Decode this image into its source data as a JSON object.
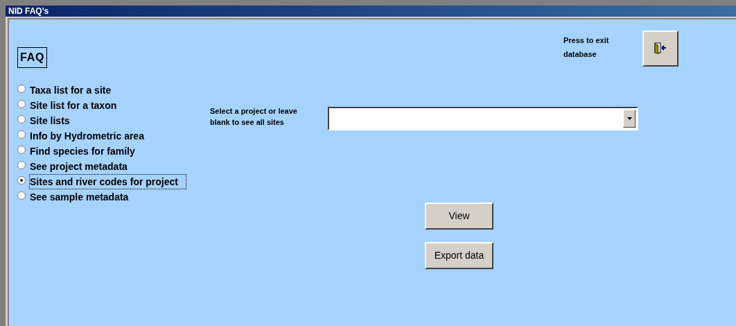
{
  "window": {
    "title": "NID FAQ's"
  },
  "heading": "FAQ",
  "options": [
    {
      "label": "Taxa list for a site",
      "selected": false
    },
    {
      "label": "Site list for a taxon",
      "selected": false
    },
    {
      "label": "Site lists",
      "selected": false
    },
    {
      "label": "Info by Hydrometric area",
      "selected": false
    },
    {
      "label": "Find species for family",
      "selected": false
    },
    {
      "label": "See project metadata",
      "selected": false
    },
    {
      "label": "Sites and river codes for project",
      "selected": true
    },
    {
      "label": "See sample metadata",
      "selected": false
    }
  ],
  "project_select": {
    "label": "Select a project or leave blank to see all sites"
  },
  "buttons": [
    "View",
    "Export data"
  ],
  "exit": {
    "label": "Press to exit database"
  }
}
